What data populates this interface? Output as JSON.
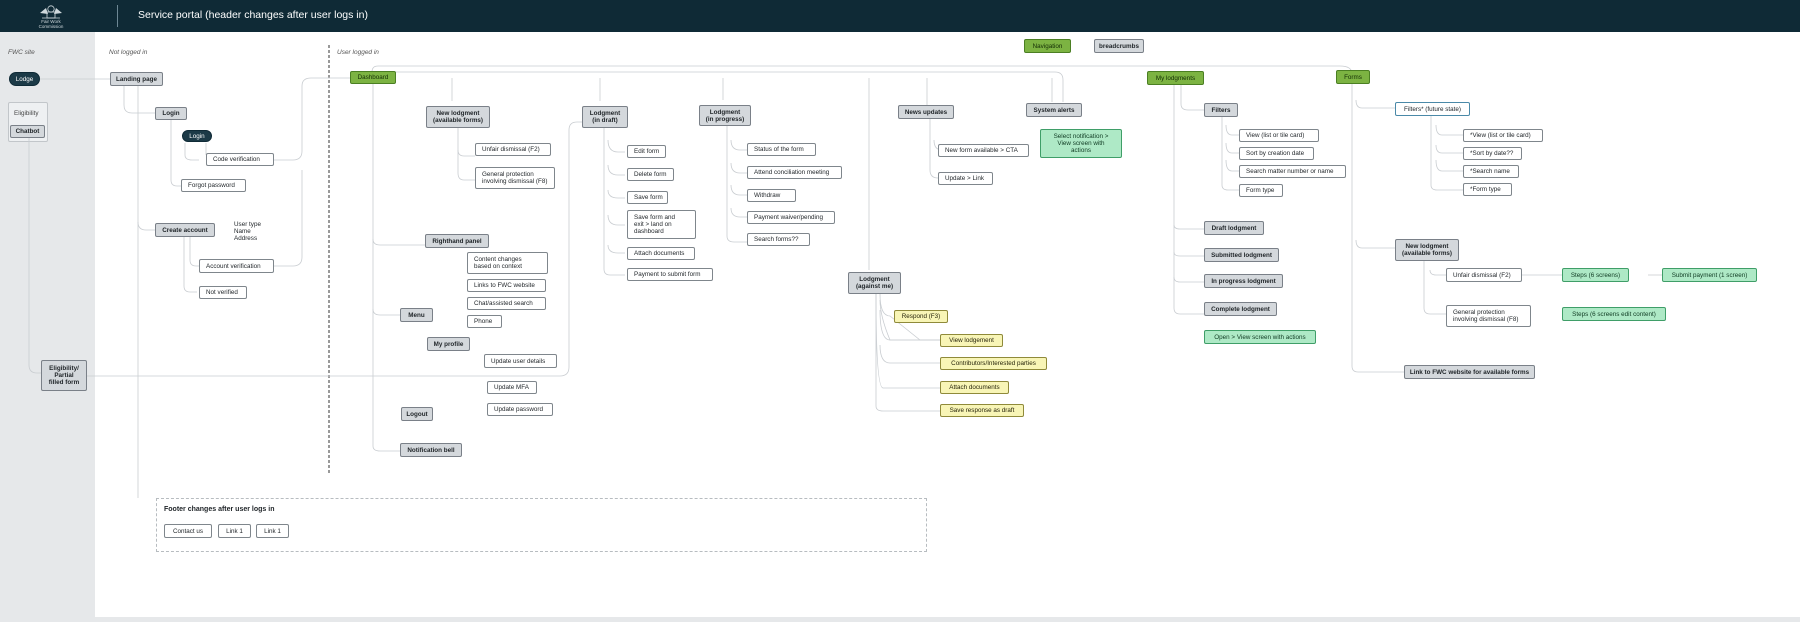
{
  "header": {
    "logo_text": "Fair Work\nCommission",
    "title": "Service portal (header changes after user logs in)"
  },
  "sections": {
    "fwc_site": "FWC site",
    "not_logged_in": "Not logged in",
    "user_logged_in": "User logged in"
  },
  "nodes": {
    "lodge": "Lodge",
    "eligibility": "Eligibility",
    "chatbot": "Chatbot",
    "eligibility_partial": "Eligibility/\nPartial\nfilled form",
    "landing_page": "Landing page",
    "login": "Login",
    "login_btn": "Login",
    "code_verification": "Code verification",
    "forgot_password": "Forgot password",
    "create_account": "Create account",
    "user_type": "User type\nName\nAddress",
    "account_verification": "Account verification",
    "not_verified": "Not verified",
    "dashboard": "Dashboard",
    "new_lodgment": "New lodgment\n(available forms)",
    "unfair_dismissal": "Unfair dismissal (F2)",
    "general_protection": "General protection\ninvolving dismissal (F8)",
    "righthand_panel": "Righthand panel",
    "content_changes": "Content changes\nbased on context",
    "links_fwc": "Links to FWC website",
    "chat_assisted": "Chat/assisted search",
    "phone": "Phone",
    "menu": "Menu",
    "my_profile": "My profile",
    "update_user_details": "Update user details",
    "update_mfa": "Update MFA",
    "update_password": "Update password",
    "logout": "Logout",
    "notification_bell": "Notification bell",
    "lodgment_draft": "Lodgment\n(in draft)",
    "edit_form": "Edit form",
    "delete_form": "Delete form",
    "save_form": "Save form",
    "save_form_exit": "Save form and\nexit > land on\ndashboard",
    "attach_documents": "Attach documents",
    "payment_submit": "Payment to submit form",
    "lodgment_progress": "Lodgment\n(in progress)",
    "status_form": "Status of the form",
    "attend_conciliation": "Attend conciliation meeting",
    "withdraw": "Withdraw",
    "payment_waiver": "Payment waiver/pending",
    "search_forms": "Search forms??",
    "news_updates": "News updates",
    "new_form_available": "New form available >  CTA",
    "update_link": "Update > Link",
    "system_alerts": "System alerts",
    "select_notification": "Select notification >\nView screen with\nactions",
    "lodgment_against": "Lodgment\n(against me)",
    "respond": "Respond (F3)",
    "view_lodgement": "View lodgement",
    "contributors": "Contributors/Interested parties",
    "attach_documents_y": "Attach documents",
    "save_response": "Save response as draft",
    "navigation": "Navigation",
    "breadcrumbs": "breadcrumbs",
    "my_lodgments": "My lodgments",
    "filters": "Filters",
    "view_list_tile": "View (list or tile card)",
    "sort_creation": "Sort by creation date",
    "search_matter": "Search matter number or name",
    "form_type": "Form type",
    "draft_lodgment": "Draft lodgment",
    "submitted_lodgment": "Submitted lodgment",
    "in_progress_lodgment": "In progress lodgment",
    "complete_lodgment": "Complete lodgment",
    "open_view": "Open > View screen with actions",
    "forms": "Forms",
    "filters_future": "Filters* (future state)",
    "f_view_list": "*View (list or tile card)",
    "f_sort_date": "*Sort by date??",
    "f_search_name": "*Search name",
    "f_form_type": "*Form type",
    "new_lodgment_forms": "New lodgment\n(available forms)",
    "unfair_dismissal_forms": "Unfair dismissal (F2)",
    "steps_6": "Steps (6 screens)",
    "submit_payment": "Submit payment (1 screen)",
    "general_protection_forms": "General protection\ninvolving dismissal (F8)",
    "steps_6_edit": "Steps (6 screens edit content)",
    "link_fwc_forms": "Link to FWC website for available forms"
  },
  "footer": {
    "title": "Footer changes after user logs in",
    "contact_us": "Contact us",
    "link1_a": "Link 1",
    "link1_b": "Link 1"
  }
}
